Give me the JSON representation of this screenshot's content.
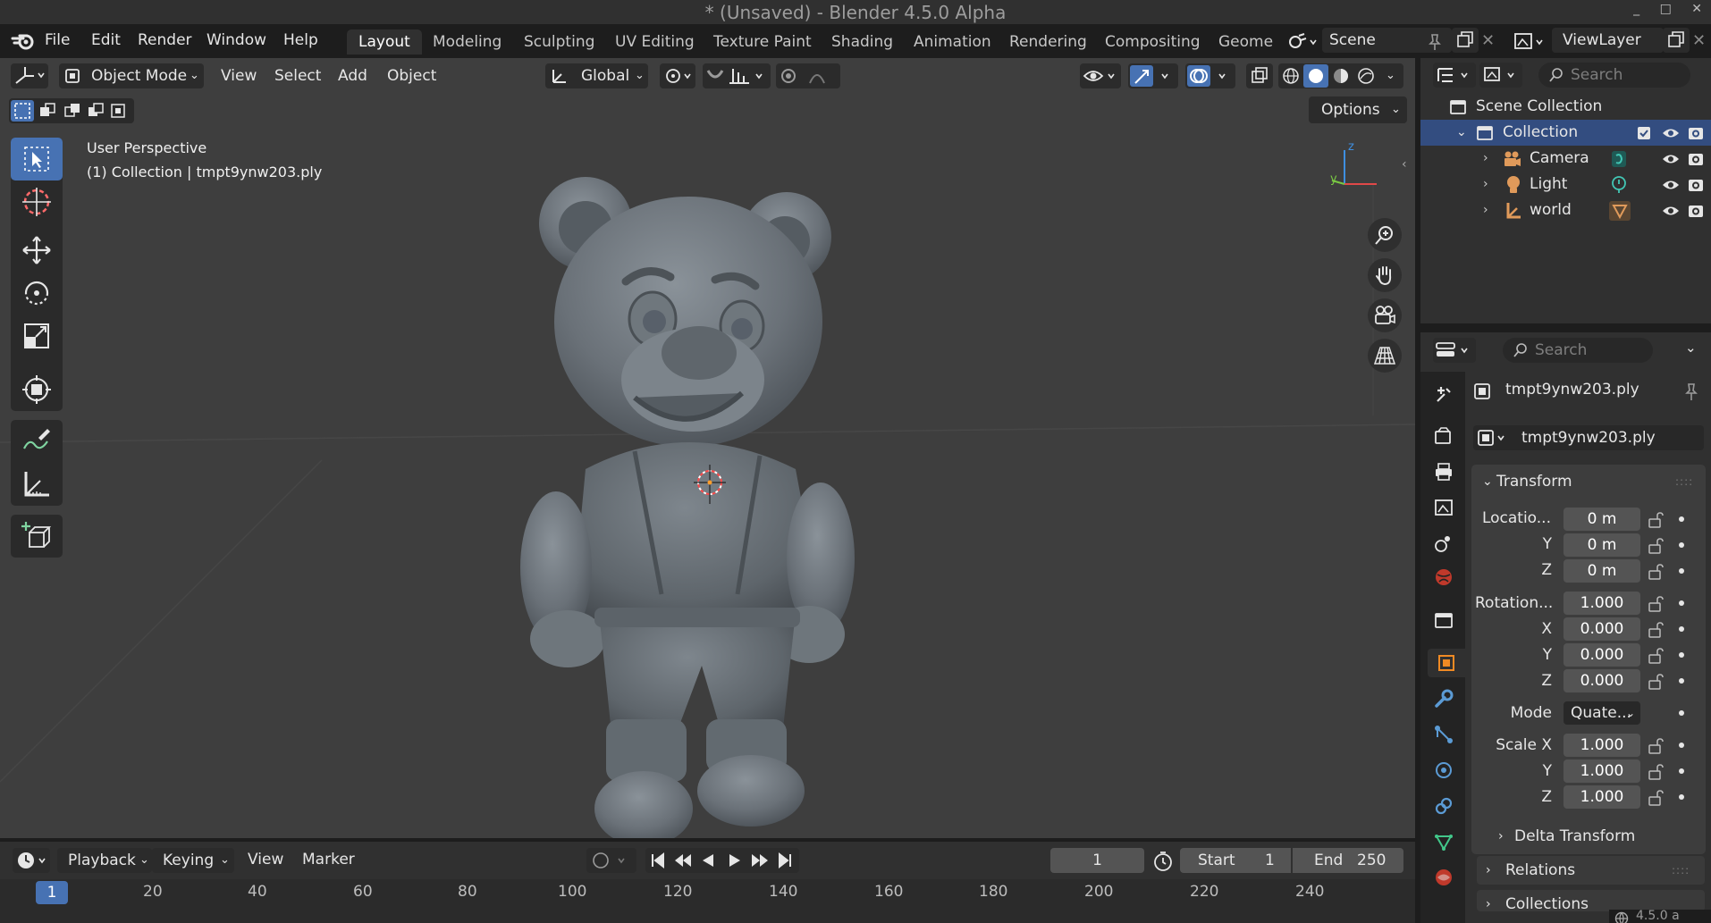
{
  "window": {
    "title": "* (Unsaved) - Blender 4.5.0 Alpha"
  },
  "menu": {
    "file": "File",
    "edit": "Edit",
    "render": "Render",
    "window": "Window",
    "help": "Help"
  },
  "workspaces": [
    "Layout",
    "Modeling",
    "Sculpting",
    "UV Editing",
    "Texture Paint",
    "Shading",
    "Animation",
    "Rendering",
    "Compositing",
    "Geomet"
  ],
  "active_workspace": "Layout",
  "scene": {
    "scene_name": "Scene",
    "view_layer": "ViewLayer"
  },
  "viewport_header": {
    "mode": "Object Mode",
    "view": "View",
    "select": "Select",
    "add": "Add",
    "object": "Object",
    "orientation": "Global",
    "options": "Options"
  },
  "viewport": {
    "perspective": "User Perspective",
    "collection_info": "(1) Collection | tmpt9ynw203.ply",
    "axis_z": "z",
    "axis_y": "y"
  },
  "timeline": {
    "playback": "Playback",
    "keying": "Keying",
    "view": "View",
    "marker": "Marker",
    "current_frame": "1",
    "start_label": "Start",
    "start": "1",
    "end_label": "End",
    "end": "250",
    "ticks": [
      "1",
      "20",
      "40",
      "60",
      "80",
      "100",
      "120",
      "140",
      "160",
      "180",
      "200",
      "220",
      "240"
    ]
  },
  "outliner": {
    "search_placeholder": "Search",
    "scene_collection": "Scene Collection",
    "collection": "Collection",
    "items": [
      "Camera",
      "Light",
      "world"
    ]
  },
  "properties": {
    "search_placeholder": "Search",
    "object_name": "tmpt9ynw203.ply",
    "data_name": "tmpt9ynw203.ply",
    "transform_label": "Transform",
    "location_label": "Locatio...",
    "location": {
      "x": "0 m",
      "y": "0 m",
      "z": "0 m"
    },
    "rotation_label": "Rotation...",
    "rotation": {
      "w": "1.000",
      "x": "0.000",
      "y": "0.000",
      "z": "0.000"
    },
    "mode_label": "Mode",
    "mode_value": "Quate...",
    "scale_label": "Scale X",
    "scale": {
      "x": "1.000",
      "y": "1.000",
      "z": "1.000"
    },
    "y_label": "Y",
    "z_label": "Z",
    "x_label": "X",
    "delta_transform": "Delta Transform",
    "relations": "Relations",
    "collections": "Collections"
  },
  "status": {
    "version": "4.5.0 a"
  }
}
